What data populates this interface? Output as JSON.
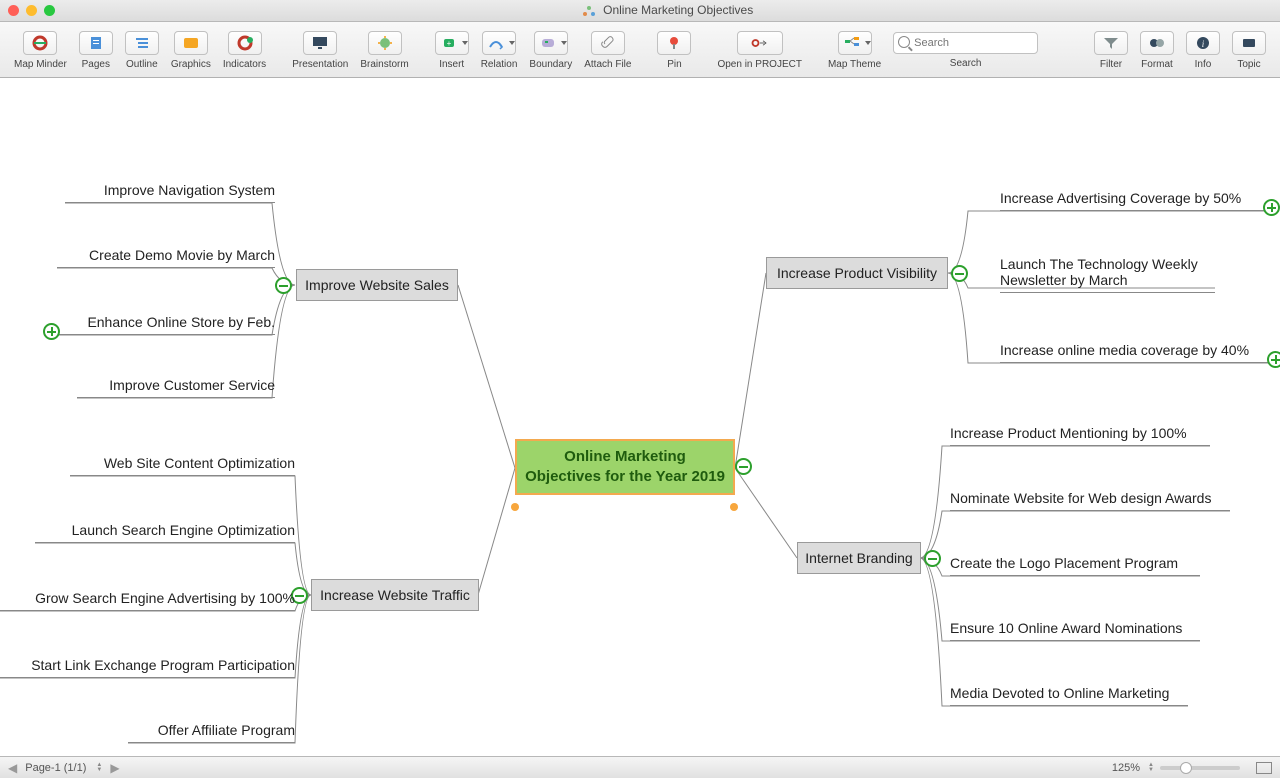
{
  "window": {
    "title": "Online Marketing Objectives"
  },
  "toolbar": {
    "groups": {
      "a": [
        {
          "id": "map-minder",
          "label": "Map Minder"
        },
        {
          "id": "pages",
          "label": "Pages"
        },
        {
          "id": "outline",
          "label": "Outline"
        },
        {
          "id": "graphics",
          "label": "Graphics"
        },
        {
          "id": "indicators",
          "label": "Indicators"
        }
      ],
      "b": [
        {
          "id": "presentation",
          "label": "Presentation"
        },
        {
          "id": "brainstorm",
          "label": "Brainstorm"
        }
      ],
      "c": [
        {
          "id": "insert",
          "label": "Insert",
          "drop": true
        },
        {
          "id": "relation",
          "label": "Relation",
          "drop": true
        },
        {
          "id": "boundary",
          "label": "Boundary",
          "drop": true
        },
        {
          "id": "attach-file",
          "label": "Attach File"
        }
      ],
      "d": [
        {
          "id": "pin",
          "label": "Pin"
        }
      ],
      "e": [
        {
          "id": "open-in-project",
          "label": "Open in PROJECT"
        }
      ],
      "f": [
        {
          "id": "map-theme",
          "label": "Map Theme",
          "drop": true
        }
      ],
      "g": [
        {
          "id": "filter",
          "label": "Filter"
        },
        {
          "id": "format",
          "label": "Format"
        },
        {
          "id": "info",
          "label": "Info"
        },
        {
          "id": "topic",
          "label": "Topic"
        }
      ]
    },
    "search": {
      "placeholder": "Search",
      "label": "Search"
    }
  },
  "mindmap": {
    "central": {
      "line1": "Online Marketing",
      "line2": "Objectives for the Year 2019"
    },
    "branches": {
      "improve_website_sales": {
        "label": "Improve Website Sales",
        "children": [
          "Improve Navigation System",
          "Create Demo Movie by March",
          "Enhance Online Store by Feb.",
          "Improve Customer Service"
        ]
      },
      "increase_website_traffic": {
        "label": "Increase Website Traffic",
        "children": [
          "Web Site Content Optimization",
          "Launch Search Engine Optimization",
          "Grow Search Engine Advertising by 100%",
          "Start Link Exchange Program Participation",
          "Offer Affiliate Program"
        ]
      },
      "increase_product_visibility": {
        "label": "Increase Product Visibility",
        "children": [
          "Increase Advertising Coverage by 50%",
          "Launch The Technology Weekly Newsletter by March",
          "Increase online media coverage by 40%"
        ]
      },
      "internet_branding": {
        "label": "Internet Branding",
        "children": [
          "Increase Product Mentioning by 100%",
          "Nominate Website for Web design Awards",
          "Create the Logo Placement Program",
          "Ensure 10 Online Award Nominations",
          "Media Devoted to Online Marketing"
        ]
      }
    }
  },
  "status": {
    "page_label": "Page-1 (1/1)",
    "zoom": "125%"
  }
}
